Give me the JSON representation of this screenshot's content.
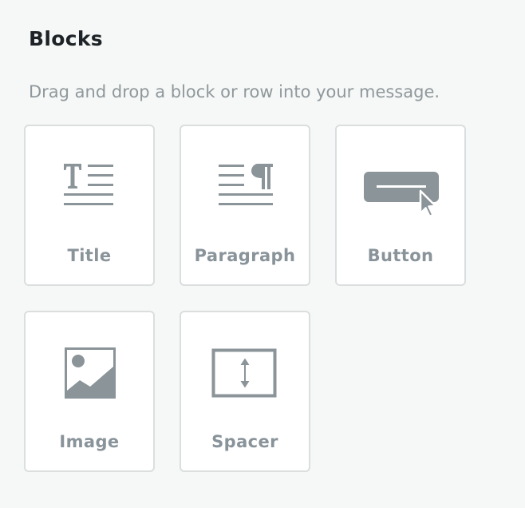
{
  "panel": {
    "title": "Blocks",
    "description": "Drag and drop a block or row into your message."
  },
  "colors": {
    "background": "#f6f7f7",
    "tile_background": "#ffffff",
    "tile_border": "#dadedf",
    "icon": "#8b9499",
    "title_text": "#1d2326",
    "muted_text": "#8f989b"
  },
  "blocks": [
    {
      "label": "Title",
      "icon": "title-icon"
    },
    {
      "label": "Paragraph",
      "icon": "paragraph-icon"
    },
    {
      "label": "Button",
      "icon": "button-icon"
    },
    {
      "label": "Image",
      "icon": "image-icon"
    },
    {
      "label": "Spacer",
      "icon": "spacer-icon"
    }
  ]
}
